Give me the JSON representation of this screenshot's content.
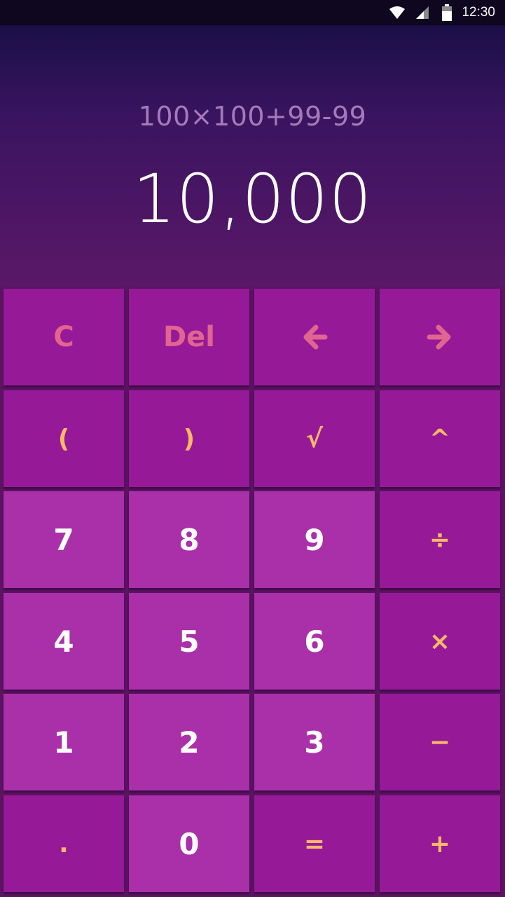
{
  "status_bar": {
    "time": "12:30",
    "icons": [
      "wifi-icon",
      "signal-icon",
      "battery-icon"
    ]
  },
  "display": {
    "expression": "100×100+99-99",
    "result": "10,000"
  },
  "keypad": {
    "rows": [
      [
        {
          "label": "C",
          "name": "clear-button"
        },
        {
          "label": "Del",
          "name": "delete-button"
        },
        {
          "label": "",
          "name": "cursor-left-button",
          "icon": "arrow-left-icon"
        },
        {
          "label": "",
          "name": "cursor-right-button",
          "icon": "arrow-right-icon"
        }
      ],
      [
        {
          "label": "(",
          "name": "open-paren-button"
        },
        {
          "label": ")",
          "name": "close-paren-button"
        },
        {
          "label": "√",
          "name": "sqrt-button"
        },
        {
          "label": "^",
          "name": "power-button"
        }
      ],
      [
        {
          "label": "7",
          "name": "digit-7-button"
        },
        {
          "label": "8",
          "name": "digit-8-button"
        },
        {
          "label": "9",
          "name": "digit-9-button"
        },
        {
          "label": "÷",
          "name": "divide-button"
        }
      ],
      [
        {
          "label": "4",
          "name": "digit-4-button"
        },
        {
          "label": "5",
          "name": "digit-5-button"
        },
        {
          "label": "6",
          "name": "digit-6-button"
        },
        {
          "label": "×",
          "name": "multiply-button"
        }
      ],
      [
        {
          "label": "1",
          "name": "digit-1-button"
        },
        {
          "label": "2",
          "name": "digit-2-button"
        },
        {
          "label": "3",
          "name": "digit-3-button"
        },
        {
          "label": "−",
          "name": "subtract-button"
        }
      ],
      [
        {
          "label": ".",
          "name": "decimal-button"
        },
        {
          "label": "0",
          "name": "digit-0-button"
        },
        {
          "label": "=",
          "name": "equals-button"
        },
        {
          "label": "+",
          "name": "add-button"
        }
      ]
    ]
  },
  "colors": {
    "status_bar_bg": "#0f061f",
    "display_top": "#1a0f47",
    "display_bottom": "#5a1868",
    "key_dark": "#961a98",
    "key_light": "#aa30aa",
    "function_text": "#e06590",
    "operator_text": "#f7b968",
    "digit_text": "#ffffff",
    "expression_text": "#a57ab8"
  }
}
